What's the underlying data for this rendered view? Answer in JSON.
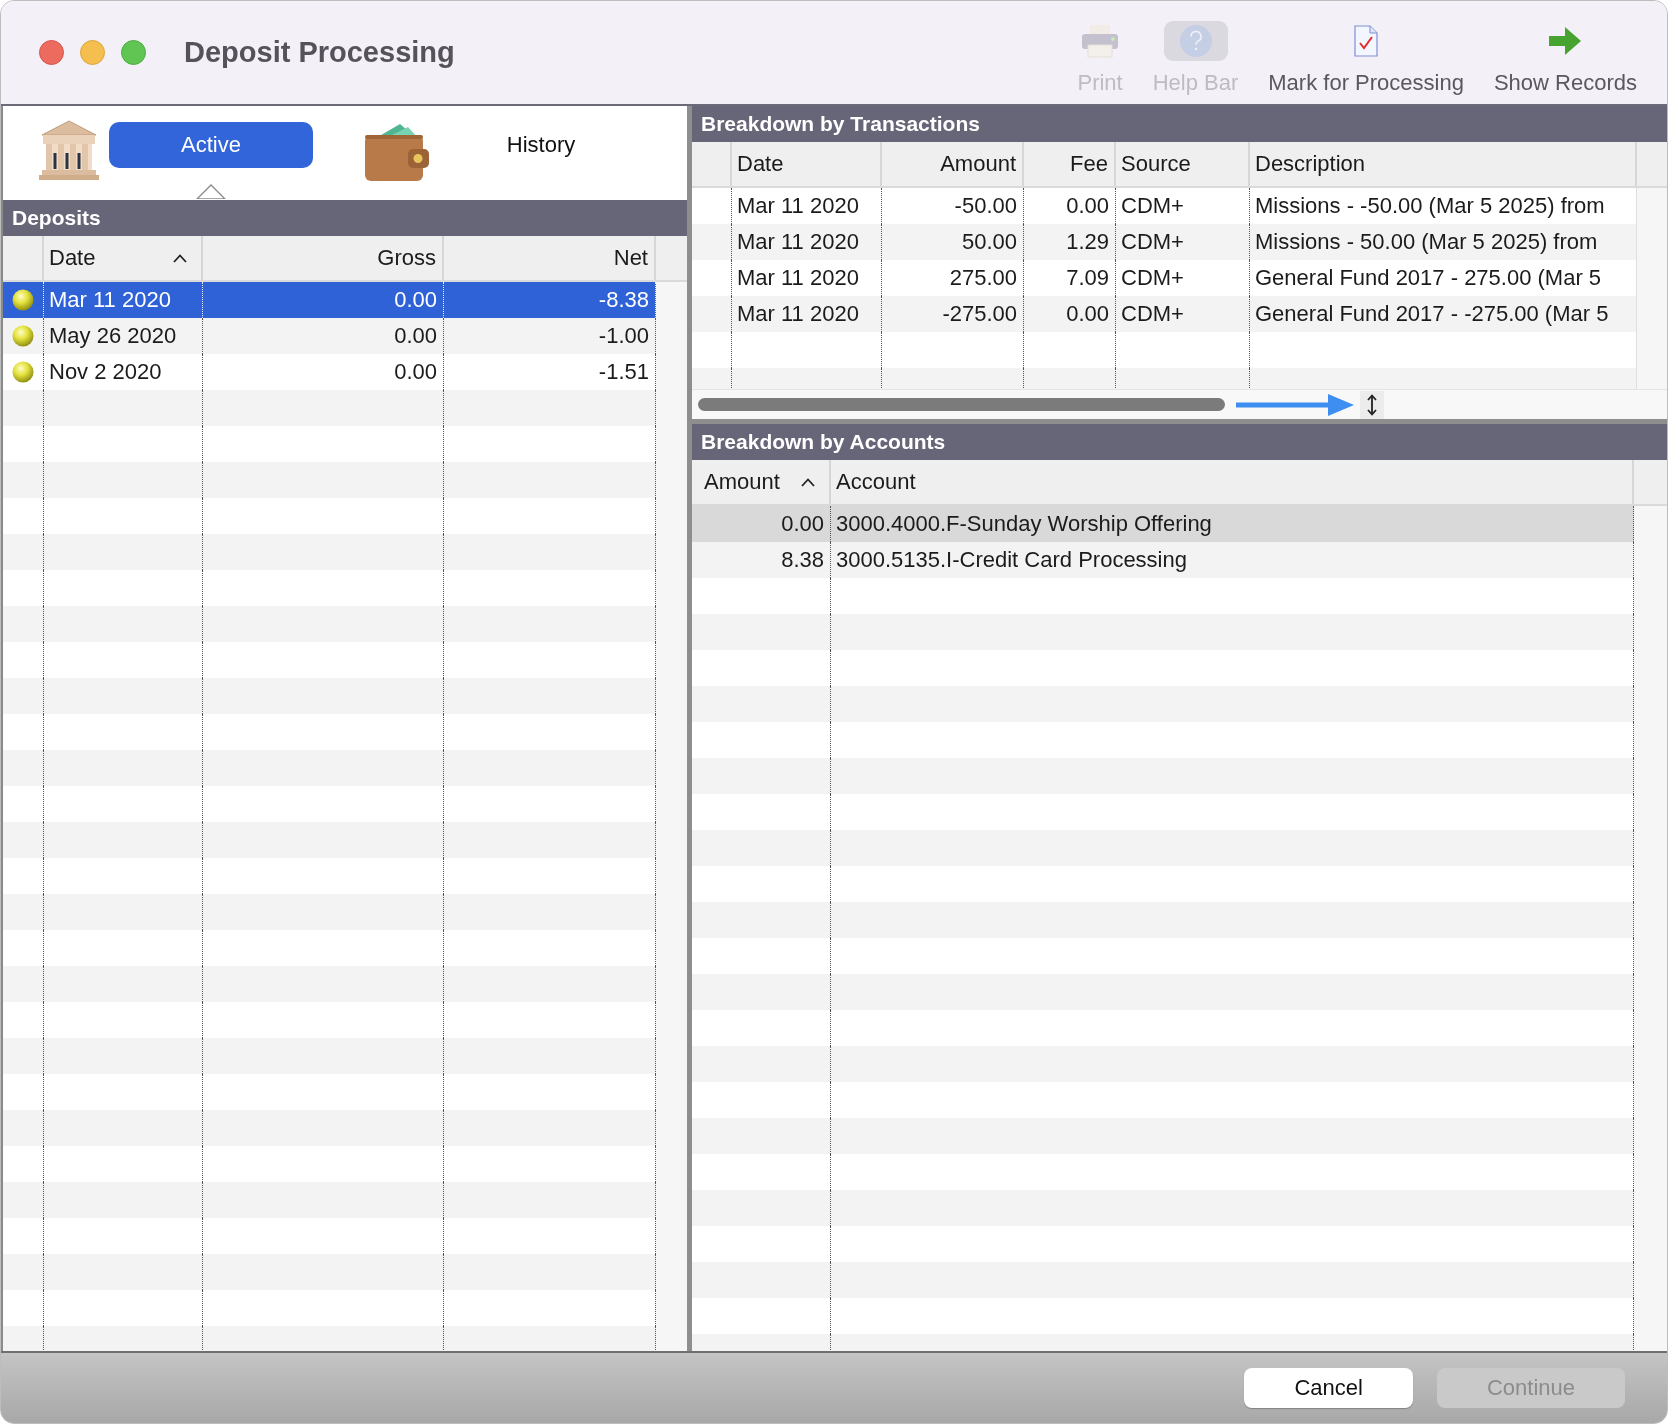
{
  "window": {
    "title": "Deposit Processing"
  },
  "toolbar": [
    {
      "kind": "printer",
      "label": "Print",
      "disabled": true
    },
    {
      "kind": "help",
      "label": "Help Bar",
      "disabled": true
    },
    {
      "kind": "document",
      "label": "Mark for Processing",
      "disabled": false
    },
    {
      "kind": "arrow",
      "label": "Show Records",
      "disabled": false
    }
  ],
  "view_tabs": [
    {
      "kind": "bank",
      "label": "Active",
      "selected": true
    },
    {
      "kind": "wallet",
      "label": "History",
      "selected": false
    }
  ],
  "deposits": {
    "title": "Deposits",
    "columns": [
      {
        "label": "Date",
        "sorted": true
      },
      {
        "label": "Gross",
        "sorted": false
      },
      {
        "label": "Net",
        "sorted": false
      }
    ],
    "rows": [
      {
        "cells": [
          "Mar 11 2020",
          "0.00",
          "-8.38"
        ],
        "selected": true
      },
      {
        "cells": [
          "May 26 2020",
          "0.00",
          "-1.00"
        ],
        "selected": false
      },
      {
        "cells": [
          "Nov 2 2020",
          "0.00",
          "-1.51"
        ],
        "selected": false
      }
    ]
  },
  "transactions": {
    "title": "Breakdown by Transactions",
    "columns": [
      "Date",
      "Amount",
      "Fee",
      "Source",
      "Description"
    ],
    "rows": [
      {
        "cells": [
          "Mar 11 2020",
          "-50.00",
          "0.00",
          "CDM+",
          "Missions - -50.00 (Mar 5 2025) from"
        ],
        "selected": false
      },
      {
        "cells": [
          "Mar 11 2020",
          "50.00",
          "1.29",
          "CDM+",
          "Missions - 50.00 (Mar 5 2025) from"
        ],
        "selected": false
      },
      {
        "cells": [
          "Mar 11 2020",
          "275.00",
          "7.09",
          "CDM+",
          "General Fund 2017 - 275.00 (Mar 5"
        ],
        "selected": false
      },
      {
        "cells": [
          "Mar 11 2020",
          "-275.00",
          "0.00",
          "CDM+",
          "General Fund 2017 - -275.00 (Mar 5"
        ],
        "selected": false
      }
    ]
  },
  "accounts": {
    "title": "Breakdown by Accounts",
    "columns": [
      {
        "label": "Amount",
        "sorted": true
      },
      {
        "label": "Account",
        "sorted": false
      }
    ],
    "rows": [
      {
        "cells": [
          "0.00",
          "3000.4000.F-Sunday Worship Offering"
        ],
        "selected": true
      },
      {
        "cells": [
          "8.38",
          "3000.5135.I-Credit Card Processing"
        ],
        "selected": false
      }
    ]
  },
  "buttons": [
    {
      "label": "Cancel",
      "disabled": false
    },
    {
      "label": "Continue",
      "disabled": true
    }
  ]
}
